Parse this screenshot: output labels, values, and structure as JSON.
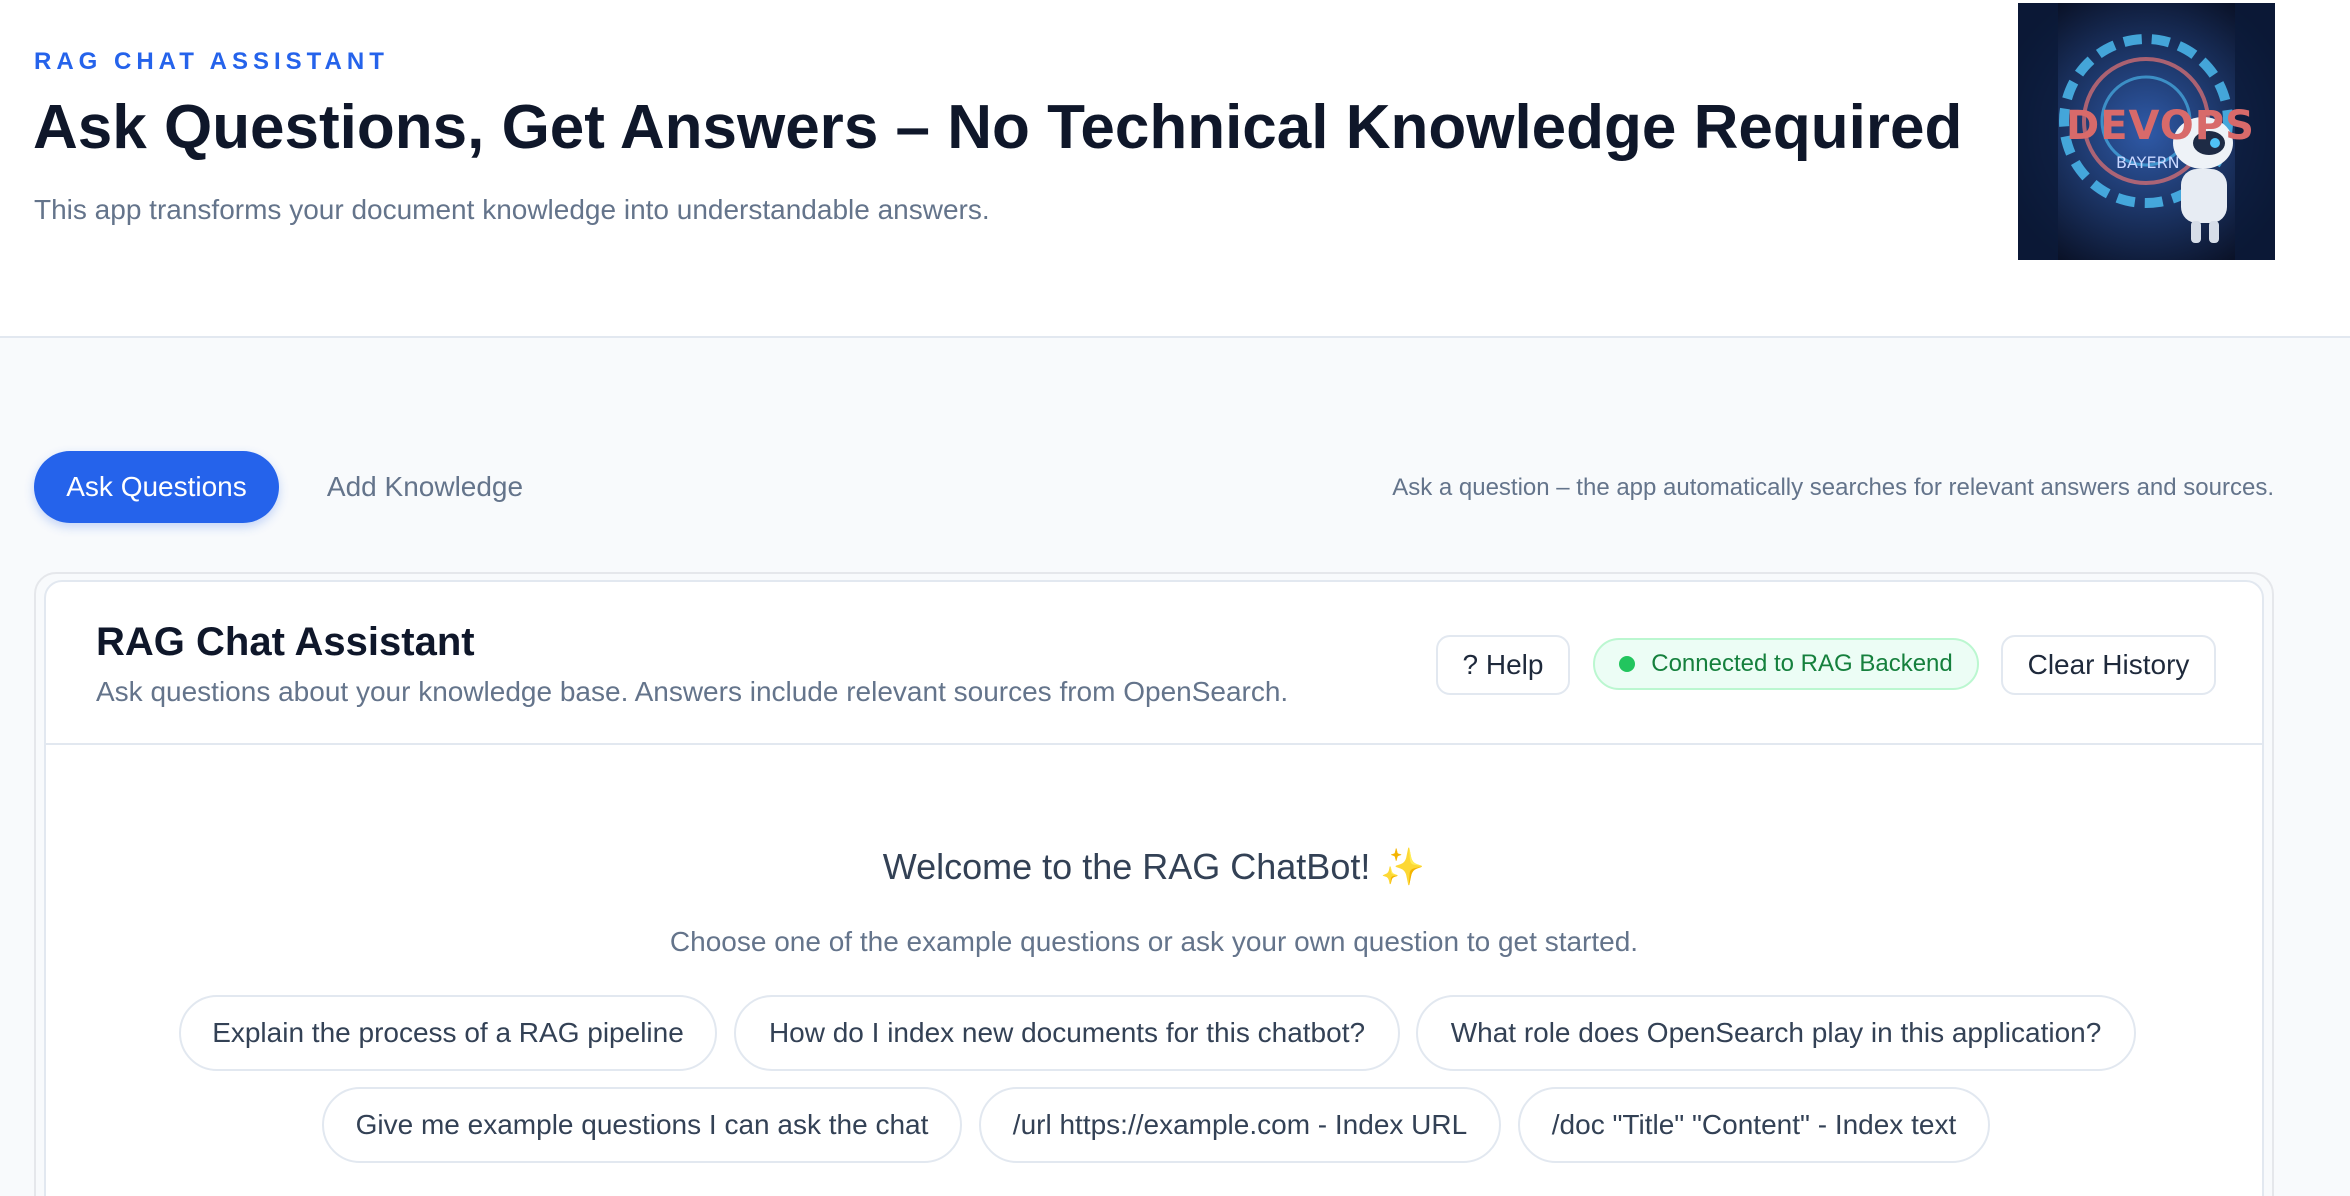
{
  "hero": {
    "eyebrow": "RAG CHAT ASSISTANT",
    "title": "Ask Questions, Get Answers – No Technical Knowledge Required",
    "subtitle": "This app transforms your document knowledge into understandable answers.",
    "logo": {
      "text": "DEVOPS",
      "subtext": "BAYERN"
    }
  },
  "tabs": {
    "ask_label": "Ask Questions",
    "add_label": "Add Knowledge",
    "hint": "Ask a question – the app automatically searches for relevant answers and sources."
  },
  "chat": {
    "title": "RAG Chat Assistant",
    "subtitle": "Ask questions about your knowledge base. Answers include relevant sources from OpenSearch.",
    "help_label": "? Help",
    "status": "Connected to RAG Backend",
    "clear_label": "Clear History",
    "welcome_title": "Welcome to the RAG ChatBot!",
    "welcome_emoji": "✨",
    "welcome_sub": "Choose one of the example questions or ask your own question to get started.",
    "examples": [
      "Explain the process of a RAG pipeline",
      "How do I index new documents for this chatbot?",
      "What role does OpenSearch play in this application?",
      "Give me example questions I can ask the chat",
      "/url https://example.com - Index URL",
      "/doc \"Title\" \"Content\" - Index text"
    ]
  },
  "colors": {
    "accent": "#2563eb",
    "status_green": "#22c55e",
    "text_muted": "#64748b"
  }
}
